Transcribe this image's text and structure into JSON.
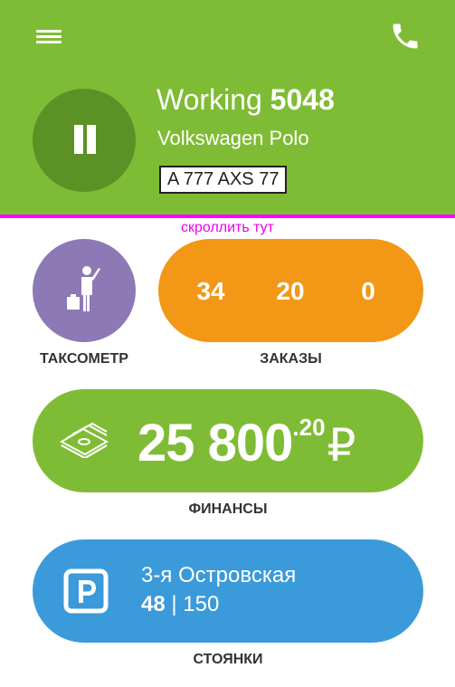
{
  "header": {
    "status_word": "Working",
    "driver_number": "5048",
    "car_model": "Volkswagen Polo",
    "license_plate": "A 777 AXS 77",
    "menu_icon": "hamburger-menu-icon",
    "phone_icon": "phone-icon",
    "pause_icon": "pause-icon"
  },
  "scroll_hint": "скроллить тут",
  "taximeter": {
    "label": "ТАКСОМЕТР",
    "icon": "passenger-hailing-icon"
  },
  "orders": {
    "label": "ЗАКАЗЫ",
    "counts": [
      "34",
      "20",
      "0"
    ]
  },
  "finance": {
    "label": "ФИНАНСЫ",
    "amount_main": "25 800",
    "amount_cents": ".20",
    "currency": "₽",
    "icon": "money-stack-icon"
  },
  "parking": {
    "label": "СТОЯНКИ",
    "name": "3-я Островская",
    "count_a": "48",
    "separator": " | ",
    "count_b": "150",
    "icon": "parking-icon"
  },
  "colors": {
    "header_green": "#7fbc35",
    "pause_dark_green": "#5b9125",
    "taximeter_purple": "#8d79b6",
    "orders_orange": "#f39716",
    "finance_green": "#7fbc35",
    "parking_blue": "#3b9ad9",
    "divider_magenta": "#ff00ff"
  }
}
